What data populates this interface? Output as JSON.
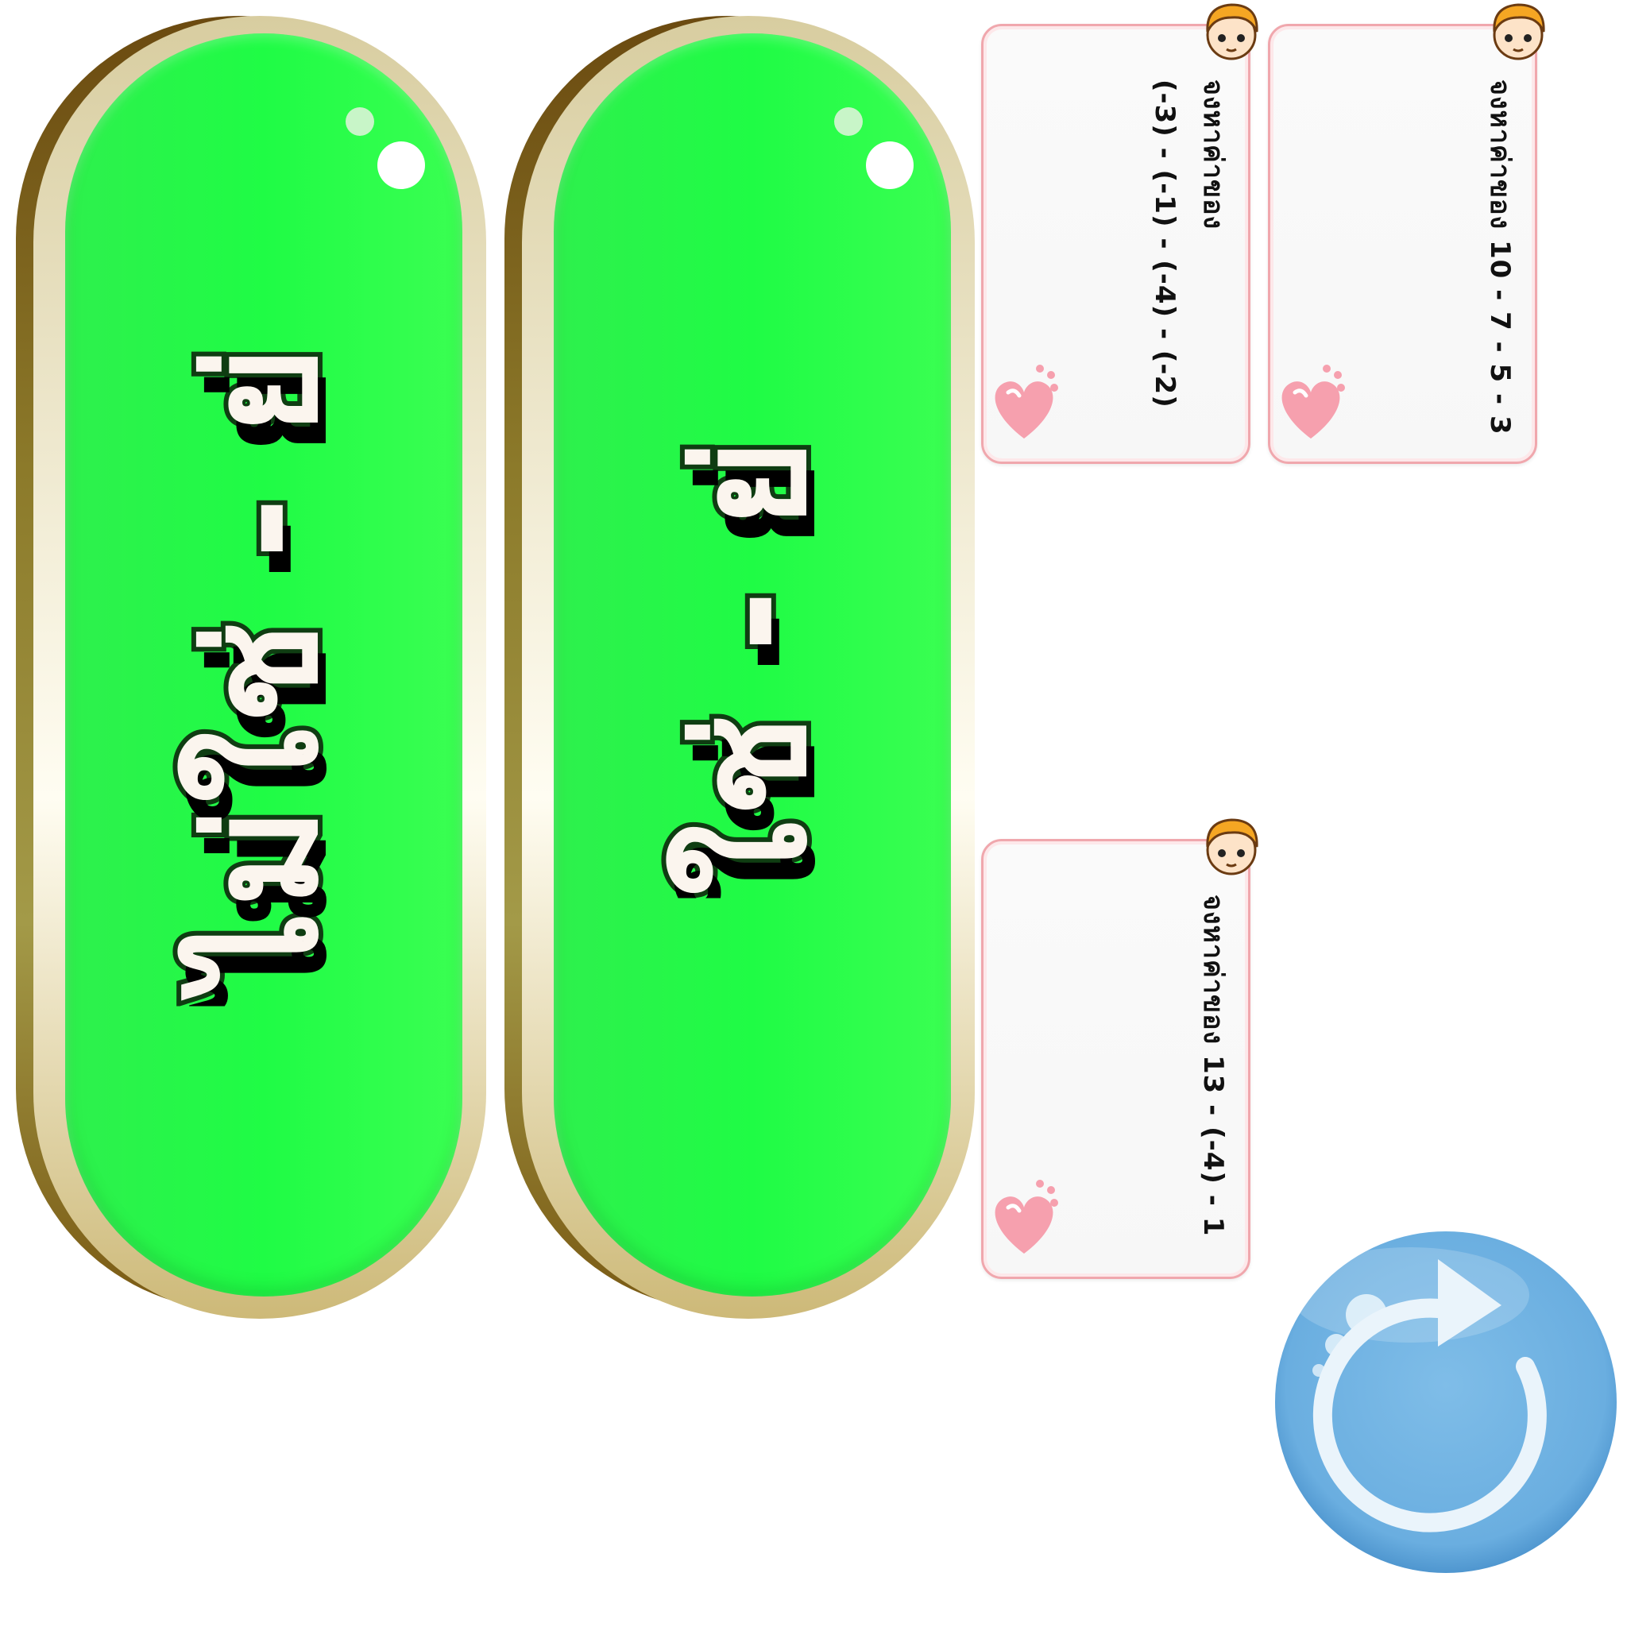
{
  "buttons": [
    {
      "label": "ไม่ใช่ - ย่"
    },
    {
      "label": "ใช่ - ย่"
    }
  ],
  "cards": [
    {
      "lines": [
        "จงหาค่าของ",
        "(-3) - (-1) - (-4) - (-2)"
      ]
    },
    {
      "lines": [
        "จงหาค่าของ  10 - 7 - 5 - 3"
      ]
    },
    {
      "lines": [
        "จงหาค่าของ  13 - (-4) - 1"
      ]
    }
  ],
  "icons": {
    "restart": "restart-icon",
    "avatar": "character-avatar-icon",
    "heart": "heart-paw-icon"
  },
  "colors": {
    "pill_green": "#1ffc45",
    "label_fill": "#fbf5ee",
    "label_outline": "#0f3d12",
    "card_border": "#f0a7ad",
    "restart_blue": "#6fb3e2"
  }
}
